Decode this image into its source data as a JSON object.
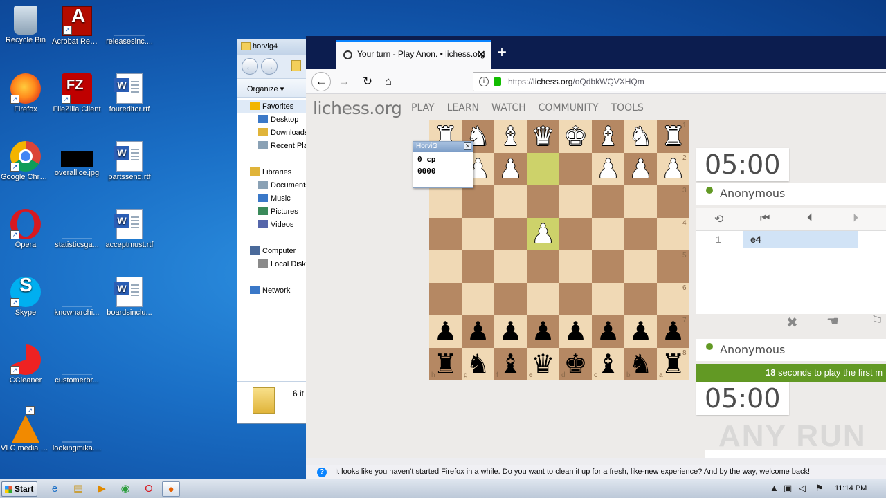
{
  "desktop": {
    "icons": [
      {
        "label": "Recycle Bin",
        "icon": "recycle-bin-icon"
      },
      {
        "label": "Acrobat Reader DC",
        "icon": "acrobat-icon"
      },
      {
        "label": "releasesinc....",
        "icon": "file-icon"
      },
      {
        "label": "Firefox",
        "icon": "firefox-icon"
      },
      {
        "label": "FileZilla Client",
        "icon": "filezilla-icon"
      },
      {
        "label": "foureditor.rtf",
        "icon": "word-doc-icon"
      },
      {
        "label": "Google Chrome",
        "icon": "chrome-icon"
      },
      {
        "label": "overallice.jpg",
        "icon": "image-icon"
      },
      {
        "label": "partssend.rtf",
        "icon": "word-doc-icon"
      },
      {
        "label": "Opera",
        "icon": "opera-icon"
      },
      {
        "label": "statisticsga...",
        "icon": "file-icon"
      },
      {
        "label": "acceptmust.rtf",
        "icon": "word-doc-icon"
      },
      {
        "label": "Skype",
        "icon": "skype-icon"
      },
      {
        "label": "knownarchi...",
        "icon": "file-icon"
      },
      {
        "label": "boardsinclu...",
        "icon": "word-doc-icon"
      },
      {
        "label": "CCleaner",
        "icon": "ccleaner-icon"
      },
      {
        "label": "customerbr...",
        "icon": "file-icon"
      },
      {
        "label": "VLC media player",
        "icon": "vlc-icon"
      },
      {
        "label": "lookingmika....",
        "icon": "file-icon"
      }
    ]
  },
  "explorer": {
    "title": "horvig4",
    "organize": "Organize ▾",
    "tree": [
      {
        "label": "Favorites",
        "icon": "star-icon"
      },
      {
        "label": "Desktop",
        "icon": "desktop-icon"
      },
      {
        "label": "Downloads",
        "icon": "downloads-icon"
      },
      {
        "label": "Recent Places",
        "icon": "recent-icon"
      },
      {
        "label": "Libraries",
        "icon": "libraries-icon"
      },
      {
        "label": "Documents",
        "icon": "documents-icon"
      },
      {
        "label": "Music",
        "icon": "music-icon"
      },
      {
        "label": "Pictures",
        "icon": "pictures-icon"
      },
      {
        "label": "Videos",
        "icon": "videos-icon"
      },
      {
        "label": "Computer",
        "icon": "computer-icon"
      },
      {
        "label": "Local Disk",
        "icon": "disk-icon"
      },
      {
        "label": "Network",
        "icon": "network-icon"
      }
    ],
    "footer_count": "6 it"
  },
  "browser": {
    "tab_title": "Your turn - Play Anon. • lichess.org",
    "url_prefix": "https://",
    "url_domain": "lichess.org",
    "url_path": "/oQdbkWQVXHQm"
  },
  "lichess": {
    "logo": "lichess.org",
    "nav": [
      "PLAY",
      "LEARN",
      "WATCH",
      "COMMUNITY",
      "TOOLS"
    ],
    "board": {
      "highlight": [
        "e2",
        "e4"
      ],
      "pieces": {
        "a1": "wR",
        "b1": "wN",
        "c1": "wB",
        "d1": "wK",
        "e1": "wQ",
        "f1": "wB",
        "g1": "wN",
        "h1": "wR",
        "a2": "wP",
        "b2": "wP",
        "c2": "wP",
        "f2": "wP",
        "g2": "wP",
        "h2": "wP",
        "e4": "wP",
        "a7": "bP",
        "b7": "bP",
        "c7": "bP",
        "d7": "bP",
        "e7": "bP",
        "f7": "bP",
        "g7": "bP",
        "h7": "bP",
        "a8": "bR",
        "b8": "bN",
        "c8": "bB",
        "d8": "bK",
        "e8": "bQ",
        "f8": "bB",
        "g8": "bN",
        "h8": "bR"
      },
      "rank_labels": [
        "1",
        "2",
        "3",
        "4",
        "5",
        "6",
        "7",
        "8"
      ],
      "file_labels": [
        "h",
        "g",
        "f",
        "e",
        "d",
        "c",
        "b",
        "a"
      ]
    },
    "engine_popup": {
      "title": "HorviG",
      "line1": "0 cp",
      "line2": "0000"
    },
    "top_clock": "05:00",
    "bottom_clock": "05:00",
    "top_player": "Anonymous",
    "bottom_player": "Anonymous",
    "move_number": "1",
    "move": "e4",
    "expiry_seconds": "18",
    "expiry_text": "seconds to play the first m"
  },
  "notification": "It looks like you haven't started Firefox in a while. Do you want to clean it up for a fresh, like-new experience? And by the way, welcome back!",
  "watermark": "ANY RUN",
  "taskbar": {
    "start_label": "Start",
    "time": "11:14 PM"
  },
  "colors": {
    "accent_green": "#629924",
    "board_light": "#f0d9b5",
    "board_dark": "#b58863",
    "move_highlight": "#cdd26a"
  }
}
